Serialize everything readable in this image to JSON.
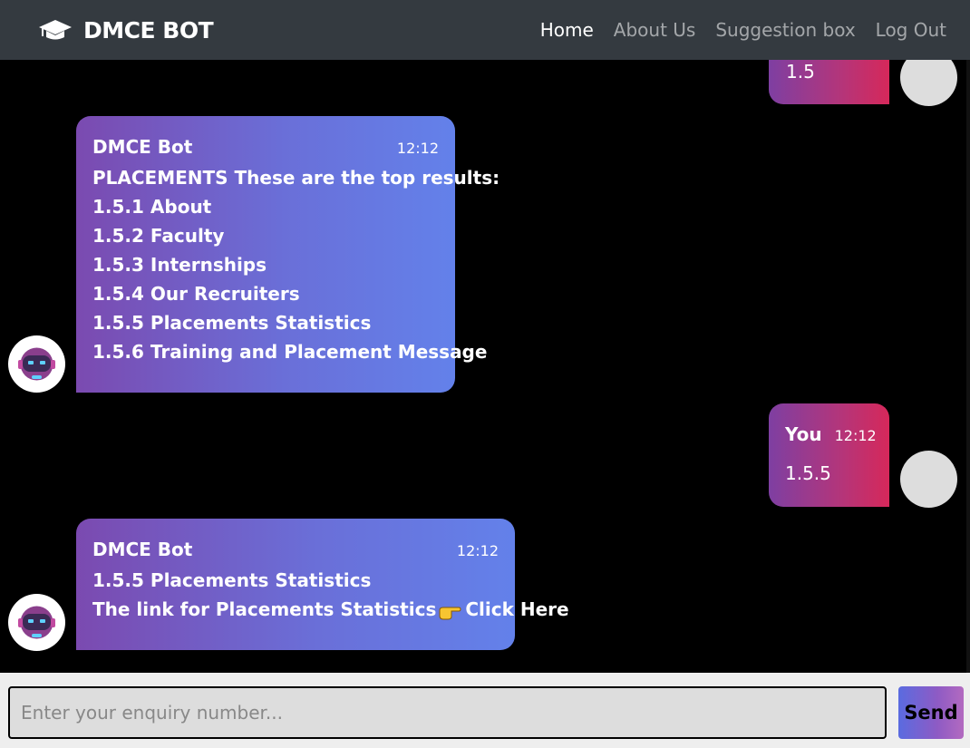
{
  "nav": {
    "brand": "DMCE BOT",
    "brand_icon": "graduation-cap-icon",
    "links": [
      {
        "label": "Home",
        "active": true
      },
      {
        "label": "About Us",
        "active": false
      },
      {
        "label": "Suggestion box",
        "active": false
      },
      {
        "label": "Log Out",
        "active": false
      }
    ]
  },
  "messages": [
    {
      "from": "user",
      "text": "1.5"
    },
    {
      "from": "bot",
      "sender": "DMCE Bot",
      "time": "12:12",
      "lines": [
        "PLACEMENTS These are the top results:",
        "1.5.1 About",
        "1.5.2 Faculty",
        "1.5.3 Internships",
        "1.5.4 Our Recruiters",
        "1.5.5 Placements Statistics",
        "1.5.6 Training and Placement Message"
      ]
    },
    {
      "from": "user",
      "sender": "You",
      "time": "12:12",
      "text": "1.5.5"
    },
    {
      "from": "bot",
      "sender": "DMCE Bot",
      "time": "12:12",
      "lines": [
        "1.5.5 Placements Statistics"
      ],
      "link_prefix": "The link for Placements Statistics",
      "link_icon": "pointing-hand-icon",
      "link_label": "Click Here"
    }
  ],
  "composer": {
    "placeholder": "Enter your enquiry number...",
    "value": "",
    "send_label": "Send"
  },
  "colors": {
    "navbar": "#343a40",
    "bot_bubble_start": "#7b4ab0",
    "bot_bubble_end": "#6381ea",
    "user_bubble_start": "#7e3fa2",
    "user_bubble_end": "#d6285a"
  }
}
